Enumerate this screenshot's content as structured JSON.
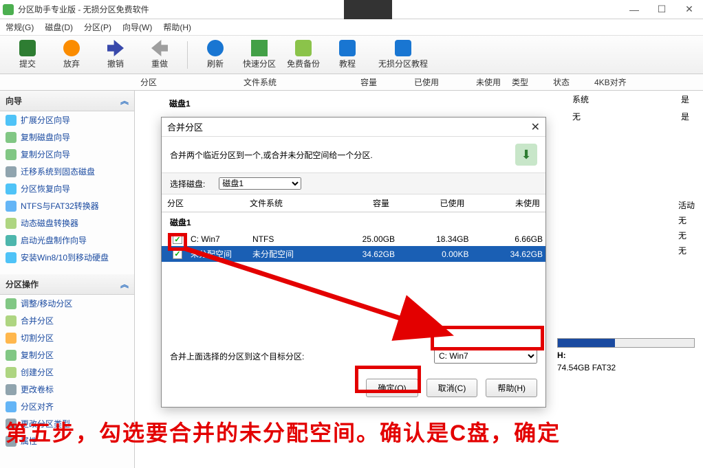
{
  "window": {
    "title": "分区助手专业版 - 无损分区免费软件",
    "menus": [
      "常规(G)",
      "磁盘(D)",
      "分区(P)",
      "向导(W)",
      "帮助(H)"
    ]
  },
  "toolbar": [
    {
      "label": "提交",
      "color": "#2e7d32"
    },
    {
      "label": "放弃",
      "color": "#fb8c00"
    },
    {
      "label": "撤销",
      "color": "#3949ab"
    },
    {
      "label": "重做",
      "color": "#9e9e9e"
    },
    {
      "label": "刷新",
      "color": "#1976d2"
    },
    {
      "label": "快速分区",
      "color": "#43a047"
    },
    {
      "label": "免费备份",
      "color": "#8bc34a"
    },
    {
      "label": "教程",
      "color": "#1976d2"
    },
    {
      "label": "无损分区教程",
      "color": "#1976d2"
    }
  ],
  "columns": [
    "分区",
    "文件系统",
    "容量",
    "已使用",
    "未使用",
    "类型",
    "状态",
    "4KB对齐"
  ],
  "disk_heading": "磁盘1",
  "sidebar": {
    "wizard_title": "向导",
    "wizard_items": [
      "扩展分区向导",
      "复制磁盘向导",
      "复制分区向导",
      "迁移系统到固态磁盘",
      "分区恢复向导",
      "NTFS与FAT32转换器",
      "动态磁盘转换器",
      "启动光盘制作向导",
      "安装Win8/10到移动硬盘"
    ],
    "ops_title": "分区操作",
    "ops_items": [
      "调整/移动分区",
      "合并分区",
      "切割分区",
      "复制分区",
      "创建分区",
      "更改卷标",
      "分区对齐",
      "更改分区类型",
      "属性"
    ]
  },
  "right_rows": [
    {
      "a": "系统",
      "b": "是"
    },
    {
      "a": "无",
      "b": "是"
    }
  ],
  "right_info": [
    "活动",
    "无",
    "无",
    "无"
  ],
  "disk_h": {
    "label": "H:",
    "sub": "74.54GB FAT32",
    "fill_pct": 42
  },
  "dialog": {
    "title": "合并分区",
    "desc": "合并两个临近分区到一个,或合并未分配空间给一个分区.",
    "select_disk_label": "选择磁盘:",
    "select_disk_value": "磁盘1",
    "grid_cols": [
      "分区",
      "文件系统",
      "容量",
      "已使用",
      "未使用"
    ],
    "disk_group": "磁盘1",
    "rows": [
      {
        "checked": true,
        "name": "C: Win7",
        "fs": "NTFS",
        "cap": "25.00GB",
        "used": "18.34GB",
        "free": "6.66GB",
        "selected": false
      },
      {
        "checked": true,
        "name": "未分配空间",
        "fs": "未分配空间",
        "cap": "34.62GB",
        "used": "0.00KB",
        "free": "34.62GB",
        "selected": true
      }
    ],
    "target_label": "合并上面选择的分区到这个目标分区:",
    "target_value": "C: Win7",
    "ok": "确定(O)",
    "cancel": "取消(C)",
    "help": "帮助(H)"
  },
  "annotation_text": "第五步，勾选要合并的未分配空间。确认是C盘，确定",
  "sidebar_last": "属性"
}
